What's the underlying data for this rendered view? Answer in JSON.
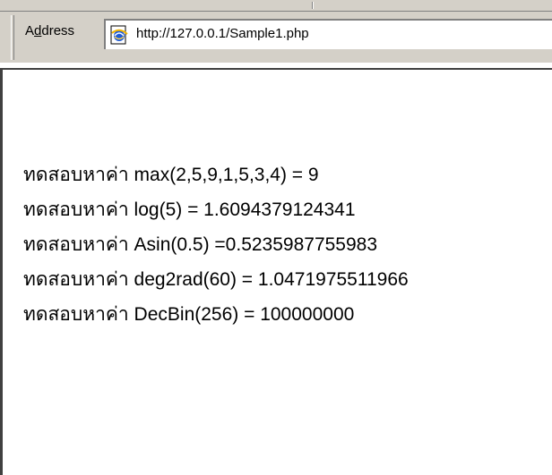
{
  "address_bar": {
    "label": "Address",
    "url": "http://127.0.0.1/Sample1.php",
    "page_icon": "ie-page-icon"
  },
  "content": {
    "lines": [
      "ทดสอบหาค่า max(2,5,9,1,5,3,4) = 9",
      "ทดสอบหาค่า log(5) = 1.6094379124341",
      "ทดสอบหาค่า Asin(0.5) =0.5235987755983",
      "ทดสอบหาค่า deg2rad(60) = 1.0471975511966",
      "ทดสอบหาค่า DecBin(256) = 100000000"
    ]
  }
}
